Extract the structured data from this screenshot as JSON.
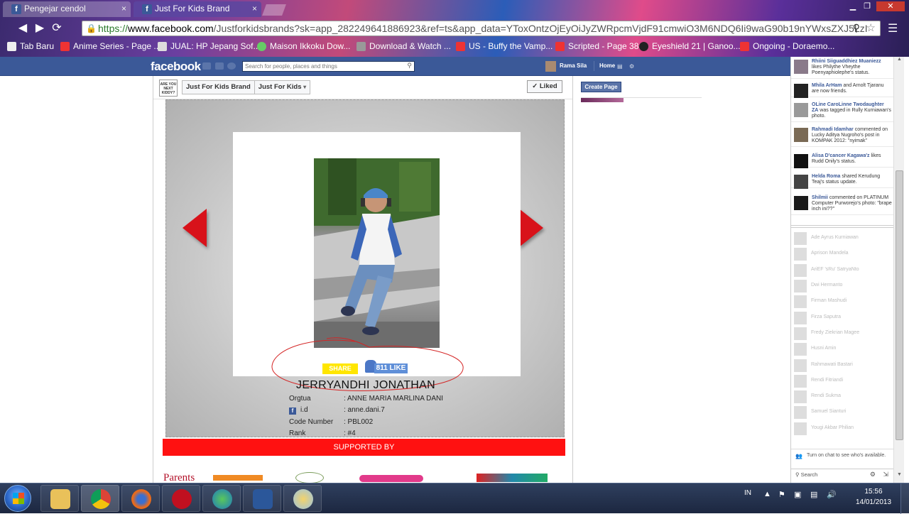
{
  "browser": {
    "tabs": [
      {
        "label": "Pengejar cendol",
        "close": "×"
      },
      {
        "label": "Just For Kids Brand",
        "close": "×"
      }
    ],
    "url_scheme": "https://",
    "url_domain": "www.facebook.com",
    "url_rest": "/Justforkidsbrands?sk=app_282249641886923&ref=ts&app_data=YToxOntzOjEyOiJyZWRpcmVjdF91cmwiO3M6NDQ6Ii9waG90b19nYWxsZXJ5LzI",
    "bookmarks": [
      "Tab Baru",
      "Anime Series - Page ...",
      "JUAL: HP Jepang Sof...",
      "Maison Ikkoku Dow...",
      "Download & Watch ...",
      "US - Buffy the Vamp...",
      "Scripted - Page 38",
      "Eyeshield 21 | Ganoo...",
      "Ongoing - Doraemo..."
    ]
  },
  "facebook": {
    "logo": "facebook",
    "search_placeholder": "Search for people, places and things",
    "user_name": "Rama Sila",
    "home": "Home",
    "page_thumb_text": "ARE YOU NEXT KIDDY?",
    "breadcrumb": [
      "Just For Kids Brand",
      "Just For Kids"
    ],
    "dropdown_arrow": "▾",
    "liked_label": "✓ Liked",
    "create_page": "Create Page"
  },
  "app": {
    "share_label": "SHARE",
    "like_label": "811 LIKE",
    "child_name": "JERRYANDHI JONATHAN",
    "info": [
      {
        "label": "Orgtua",
        "value": ": ANNE MARIA MARLINA DANI",
        "fb_icon": false
      },
      {
        "label": "i.d",
        "value": ": anne.dani.7",
        "fb_icon": true
      },
      {
        "label": "Code Number",
        "value": ": PBL002",
        "fb_icon": false
      },
      {
        "label": "Rank",
        "value": ": #4",
        "fb_icon": false
      }
    ],
    "supported_by": "SUPPORTED BY",
    "sponsor_1": "Parents"
  },
  "ticker": [
    {
      "name": "Rhiini Siiguaddhiez Muaniezz",
      "text": "likes Philythe Vheythe Poenyaphiolephe's status."
    },
    {
      "name": "Mhila ArHam",
      "text": "and Arnolt Tjaranu are now friends."
    },
    {
      "name": "OLine CaroLinne Twodaughter ZA",
      "text": "was tagged in Rully Kurniawan's photo."
    },
    {
      "name": "Rahmadi Idamhar",
      "text": "commented on Lucky Aditya Nugroho's post in KOMPAK 2012: \"nyimak\""
    },
    {
      "name": "Alisa D'cancer Kagawa'z",
      "text": "likes Rudd Onily's status."
    },
    {
      "name": "Helda Roma",
      "text": "shared Kerudung Teaj's status update."
    },
    {
      "name": "Shilmii",
      "text": "commented on PLATINUM Computer Purworejo's photo: \"brape inch ini??\""
    }
  ],
  "chat_friends": [
    "Ade Ayrus Kurniawan",
    "Aprison Mandela",
    "AriEF 'sRu' SatryaNto",
    "Dwi Hermanto",
    "Firman Mashudi",
    "Firza Saputra",
    "Fredy Ziekrian Magee",
    "Husni Amin",
    "Rahmawati Bastari",
    "Rendi Fitriandi",
    "Rendi Sukma",
    "Samuel Sianturi",
    "Yougi Akbar Philian"
  ],
  "chat": {
    "turn_on": "Turn on chat to see who's available.",
    "search": "Search"
  },
  "taskbar": {
    "language": "IN",
    "time": "15:56",
    "date": "14/01/2013"
  }
}
